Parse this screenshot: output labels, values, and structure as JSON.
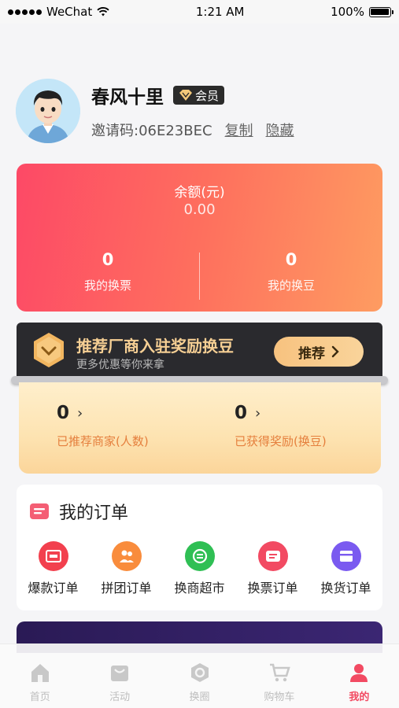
{
  "status_bar": {
    "carrier": "WeChat",
    "time": "1:21 AM",
    "battery": "100%"
  },
  "profile": {
    "name": "春风十里",
    "badge": "会员",
    "invite": "邀请码:06E23BEC",
    "copy_label": "复制",
    "hide_label": "隐藏"
  },
  "balance": {
    "label": "余额(元)",
    "value": "0.00",
    "tickets_value": "0",
    "tickets_label": "我的换票",
    "beans_value": "0",
    "beans_label": "我的换豆"
  },
  "promo": {
    "title": "推荐厂商入驻奖励换豆",
    "subtitle": "更多优惠等你来拿",
    "button_label": "推荐"
  },
  "rewards": {
    "merchants_value": "0",
    "merchants_label": "已推荐商家(人数)",
    "beans_value": "0",
    "beans_label": "已获得奖励(换豆)"
  },
  "orders": {
    "title": "我的订单",
    "items": [
      {
        "label": "爆款订单",
        "icon": "hot-order-icon",
        "color": "#f2404e"
      },
      {
        "label": "拼团订单",
        "icon": "group-order-icon",
        "color": "#f98c3c"
      },
      {
        "label": "换商超市",
        "icon": "exchange-market-icon",
        "color": "#2fbf54"
      },
      {
        "label": "换票订单",
        "icon": "ticket-order-icon",
        "color": "#f24a62"
      },
      {
        "label": "换货订单",
        "icon": "goods-order-icon",
        "color": "#7a5af0"
      }
    ]
  },
  "tabs": [
    {
      "label": "首页",
      "icon": "home-icon",
      "active": false
    },
    {
      "label": "活动",
      "icon": "activity-icon",
      "active": false
    },
    {
      "label": "换圈",
      "icon": "exchange-circle-icon",
      "active": false
    },
    {
      "label": "购物车",
      "icon": "cart-icon",
      "active": false
    },
    {
      "label": "我的",
      "icon": "profile-icon",
      "active": true
    }
  ],
  "colors": {
    "accent": "#f24a62",
    "gold": "#f6cf94"
  }
}
